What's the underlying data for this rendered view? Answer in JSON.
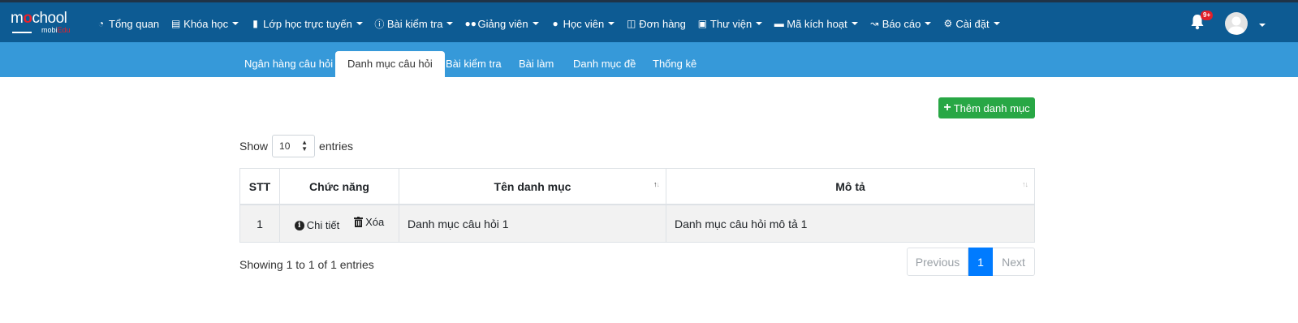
{
  "brand": {
    "logo_prefix": "m",
    "logo_o": "o",
    "logo_suffix": "chool",
    "logo_sub": "mobi",
    "logo_sub_accent": "Edu"
  },
  "nav": {
    "items": [
      {
        "label": "Tổng quan",
        "icon": "dashboard-icon"
      },
      {
        "label": "Khóa học",
        "icon": "list-icon",
        "dropdown": true
      },
      {
        "label": "Lớp học trực tuyến",
        "icon": "video-icon",
        "dropdown": true
      },
      {
        "label": "Bài kiểm tra",
        "icon": "question-icon",
        "dropdown": true
      },
      {
        "label": "Giảng viên",
        "icon": "users-icon",
        "dropdown": true
      },
      {
        "label": "Học viên",
        "icon": "user-icon",
        "dropdown": true
      },
      {
        "label": "Đơn hàng",
        "icon": "cart-icon"
      },
      {
        "label": "Thư viện",
        "icon": "book-icon",
        "dropdown": true
      },
      {
        "label": "Mã kích hoạt",
        "icon": "card-icon",
        "dropdown": true
      },
      {
        "label": "Báo cáo",
        "icon": "chart-icon",
        "dropdown": true
      },
      {
        "label": "Cài đặt",
        "icon": "gears-icon",
        "dropdown": true
      }
    ],
    "notification_badge": "9+"
  },
  "tabs": [
    {
      "label": "Ngân hàng câu hỏi"
    },
    {
      "label": "Danh mục câu hỏi",
      "active": true
    },
    {
      "label": "Bài kiểm tra"
    },
    {
      "label": "Bài làm"
    },
    {
      "label": "Danh mục đề"
    },
    {
      "label": "Thống kê"
    }
  ],
  "toolbar": {
    "add_label": "Thêm danh mục"
  },
  "length": {
    "show": "Show",
    "value": "10",
    "entries": "entries"
  },
  "table": {
    "headers": {
      "stt": "STT",
      "actions": "Chức năng",
      "name": "Tên danh mục",
      "desc": "Mô tả"
    },
    "detail_label": "Chi tiết",
    "delete_label": "Xóa",
    "rows": [
      {
        "stt": "1",
        "name": "Danh mục câu hỏi 1",
        "desc": "Danh mục câu hỏi mô tả 1"
      }
    ]
  },
  "pagination": {
    "info": "Showing 1 to 1 of 1 entries",
    "previous": "Previous",
    "current": "1",
    "next": "Next"
  },
  "colors": {
    "topbar": "#0d5b93",
    "subbar": "#3699d9",
    "add_button": "#28a745",
    "active_page": "#007bff"
  }
}
